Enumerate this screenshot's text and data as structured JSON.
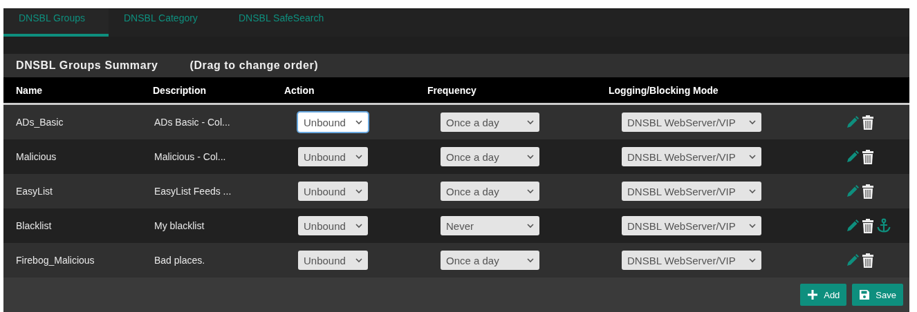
{
  "tabs": [
    {
      "label": "DNSBL Groups",
      "selected": true
    },
    {
      "label": "DNSBL Category",
      "selected": false
    },
    {
      "label": "DNSBL SafeSearch",
      "selected": false
    }
  ],
  "summary": {
    "title": "DNSBL Groups Summary",
    "hint": "(Drag to change order)"
  },
  "table": {
    "columns": [
      "Name",
      "Description",
      "Action",
      "Frequency",
      "Logging/Blocking Mode"
    ],
    "rows": [
      {
        "name": "ADs_Basic",
        "description": "ADs Basic - Col...",
        "action": "Unbound",
        "action_focused": true,
        "frequency": "Once a day",
        "mode": "DNSBL WebServer/VIP",
        "anchor": false
      },
      {
        "name": "Malicious",
        "description": "Malicious - Col...",
        "action": "Unbound",
        "action_focused": false,
        "frequency": "Once a day",
        "mode": "DNSBL WebServer/VIP",
        "anchor": false
      },
      {
        "name": "EasyList",
        "description": "EasyList Feeds ...",
        "action": "Unbound",
        "action_focused": false,
        "frequency": "Once a day",
        "mode": "DNSBL WebServer/VIP",
        "anchor": false
      },
      {
        "name": "Blacklist",
        "description": "My blacklist",
        "action": "Unbound",
        "action_focused": false,
        "frequency": "Never",
        "mode": "DNSBL WebServer/VIP",
        "anchor": true
      },
      {
        "name": "Firebog_Malicious",
        "description": "Bad places.",
        "action": "Unbound",
        "action_focused": false,
        "frequency": "Once a day",
        "mode": "DNSBL WebServer/VIP",
        "anchor": false
      }
    ]
  },
  "buttons": [
    {
      "kind": "add",
      "label": "Add"
    },
    {
      "kind": "save",
      "label": "Save"
    }
  ]
}
